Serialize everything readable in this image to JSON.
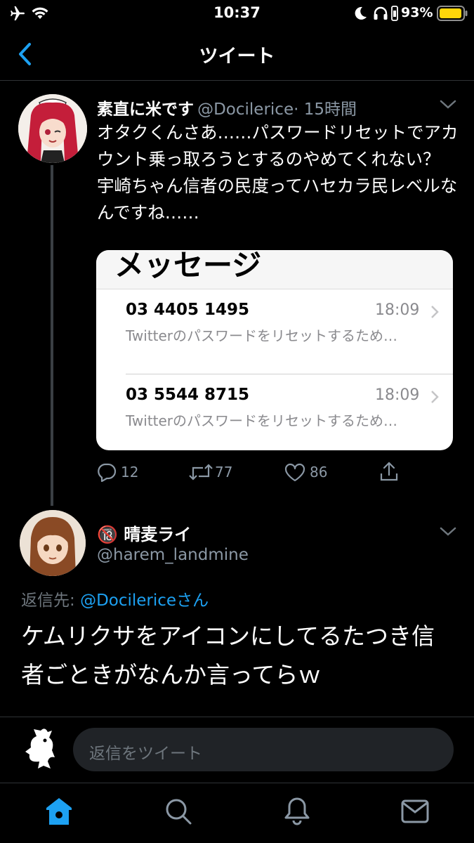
{
  "status_bar": {
    "time": "10:37",
    "battery_pct": "93%"
  },
  "nav": {
    "title": "ツイート"
  },
  "tweet1": {
    "name": "素直に米です",
    "handle": "@Docilerice",
    "age": "· 15時間",
    "text": "オタクくんさあ……パスワードリセットでアカウント乗っ取ろうとするのやめてくれない？\n宇崎ちゃん信者の民度ってハセカラ民レベルなんですね……",
    "embed": {
      "title": "メッセージ",
      "messages": [
        {
          "number": "03 4405 1495",
          "time": "18:09",
          "preview": "Twitterのパスワードをリセットするため…"
        },
        {
          "number": "03 5544 8715",
          "time": "18:09",
          "preview": "Twitterのパスワードをリセットするため…"
        }
      ]
    },
    "counts": {
      "replies": "12",
      "retweets": "77",
      "likes": "86"
    }
  },
  "tweet2": {
    "badge": "🔞",
    "name": "晴麦ライ",
    "handle": "@harem_landmine",
    "reply_prefix": "返信先: ",
    "reply_handle": "@Docilericeさん",
    "text": "ケムリクサをアイコンにしてるたつき信者ごときがなんか言ってらｗ"
  },
  "reply_bar": {
    "placeholder": "返信をツイート"
  },
  "colors": {
    "accent": "#1da1f2",
    "background": "#000000",
    "secondary_text": "#8b98a5"
  },
  "icons": [
    "airplane-icon",
    "wifi-icon",
    "moon-icon",
    "headphones-icon",
    "battery-icon",
    "back-chevron-icon",
    "chevron-down-icon",
    "reply-icon",
    "retweet-icon",
    "like-icon",
    "share-icon",
    "home-icon",
    "search-icon",
    "bell-icon",
    "mail-icon"
  ]
}
